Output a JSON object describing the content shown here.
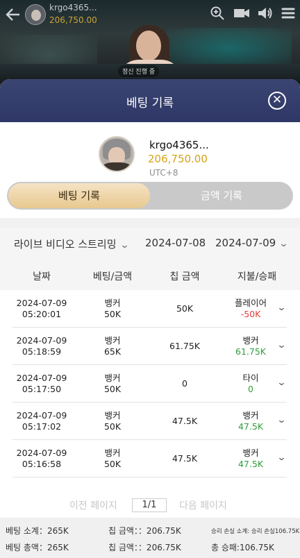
{
  "topbar": {
    "username": "krgo4365...",
    "balance": "206,750.00",
    "live_tag": "정신 진행 중"
  },
  "modal": {
    "title": "베팅 기록",
    "close_symbol": "✕"
  },
  "profile": {
    "name": "krgo4365...",
    "balance": "206,750.00",
    "timezone": "UTC+8"
  },
  "tabs": [
    {
      "label": "베팅 기록",
      "active": true
    },
    {
      "label": "금액 기록",
      "active": false
    }
  ],
  "filters": {
    "game": "라이브 비디오 스트리밍",
    "start_date": "2024-07-08",
    "end_date": "2024-07-09"
  },
  "columns": [
    "날짜",
    "베팅/금액",
    "칩 금액",
    "지불/승패"
  ],
  "rows": [
    {
      "date": "2024-07-09",
      "time": "05:20:01",
      "bet": "뱅커",
      "amount": "50K",
      "chip": "50K",
      "result": "플레이어",
      "payout": "-50K",
      "status": "neg"
    },
    {
      "date": "2024-07-09",
      "time": "05:18:59",
      "bet": "뱅커",
      "amount": "65K",
      "chip": "61.75K",
      "result": "뱅커",
      "payout": "61.75K",
      "status": "pos"
    },
    {
      "date": "2024-07-09",
      "time": "05:17:50",
      "bet": "뱅커",
      "amount": "50K",
      "chip": "0",
      "result": "타이",
      "payout": "0",
      "status": "pos"
    },
    {
      "date": "2024-07-09",
      "time": "05:17:02",
      "bet": "뱅커",
      "amount": "50K",
      "chip": "47.5K",
      "result": "뱅커",
      "payout": "47.5K",
      "status": "pos"
    },
    {
      "date": "2024-07-09",
      "time": "05:16:58",
      "bet": "뱅커",
      "amount": "50K",
      "chip": "47.5K",
      "result": "뱅커",
      "payout": "47.5K",
      "status": "pos"
    }
  ],
  "pager": {
    "prev": "이전 페이지",
    "current": "1/1",
    "next": "다음 페이지"
  },
  "summary": {
    "bet_subtotal": "베팅 소계：265K",
    "chip_subtotal": "칩 금액：：206.75K",
    "win_subtotal": "승리 손실 소계: 승리 손실106.75K",
    "bet_total": "베팅 총액：265K",
    "chip_total": "칩 금액：：206.75K",
    "win_total": "총 승패:106.75K"
  },
  "colors": {
    "header": "#2e3766",
    "gold": "#d6a21a",
    "loss": "#e0403a",
    "win": "#2e9e3a"
  },
  "icons": [
    "back-icon",
    "zoom-icon",
    "camera-icon",
    "speaker-icon",
    "menu-icon",
    "close-icon",
    "chevron-down-icon"
  ]
}
